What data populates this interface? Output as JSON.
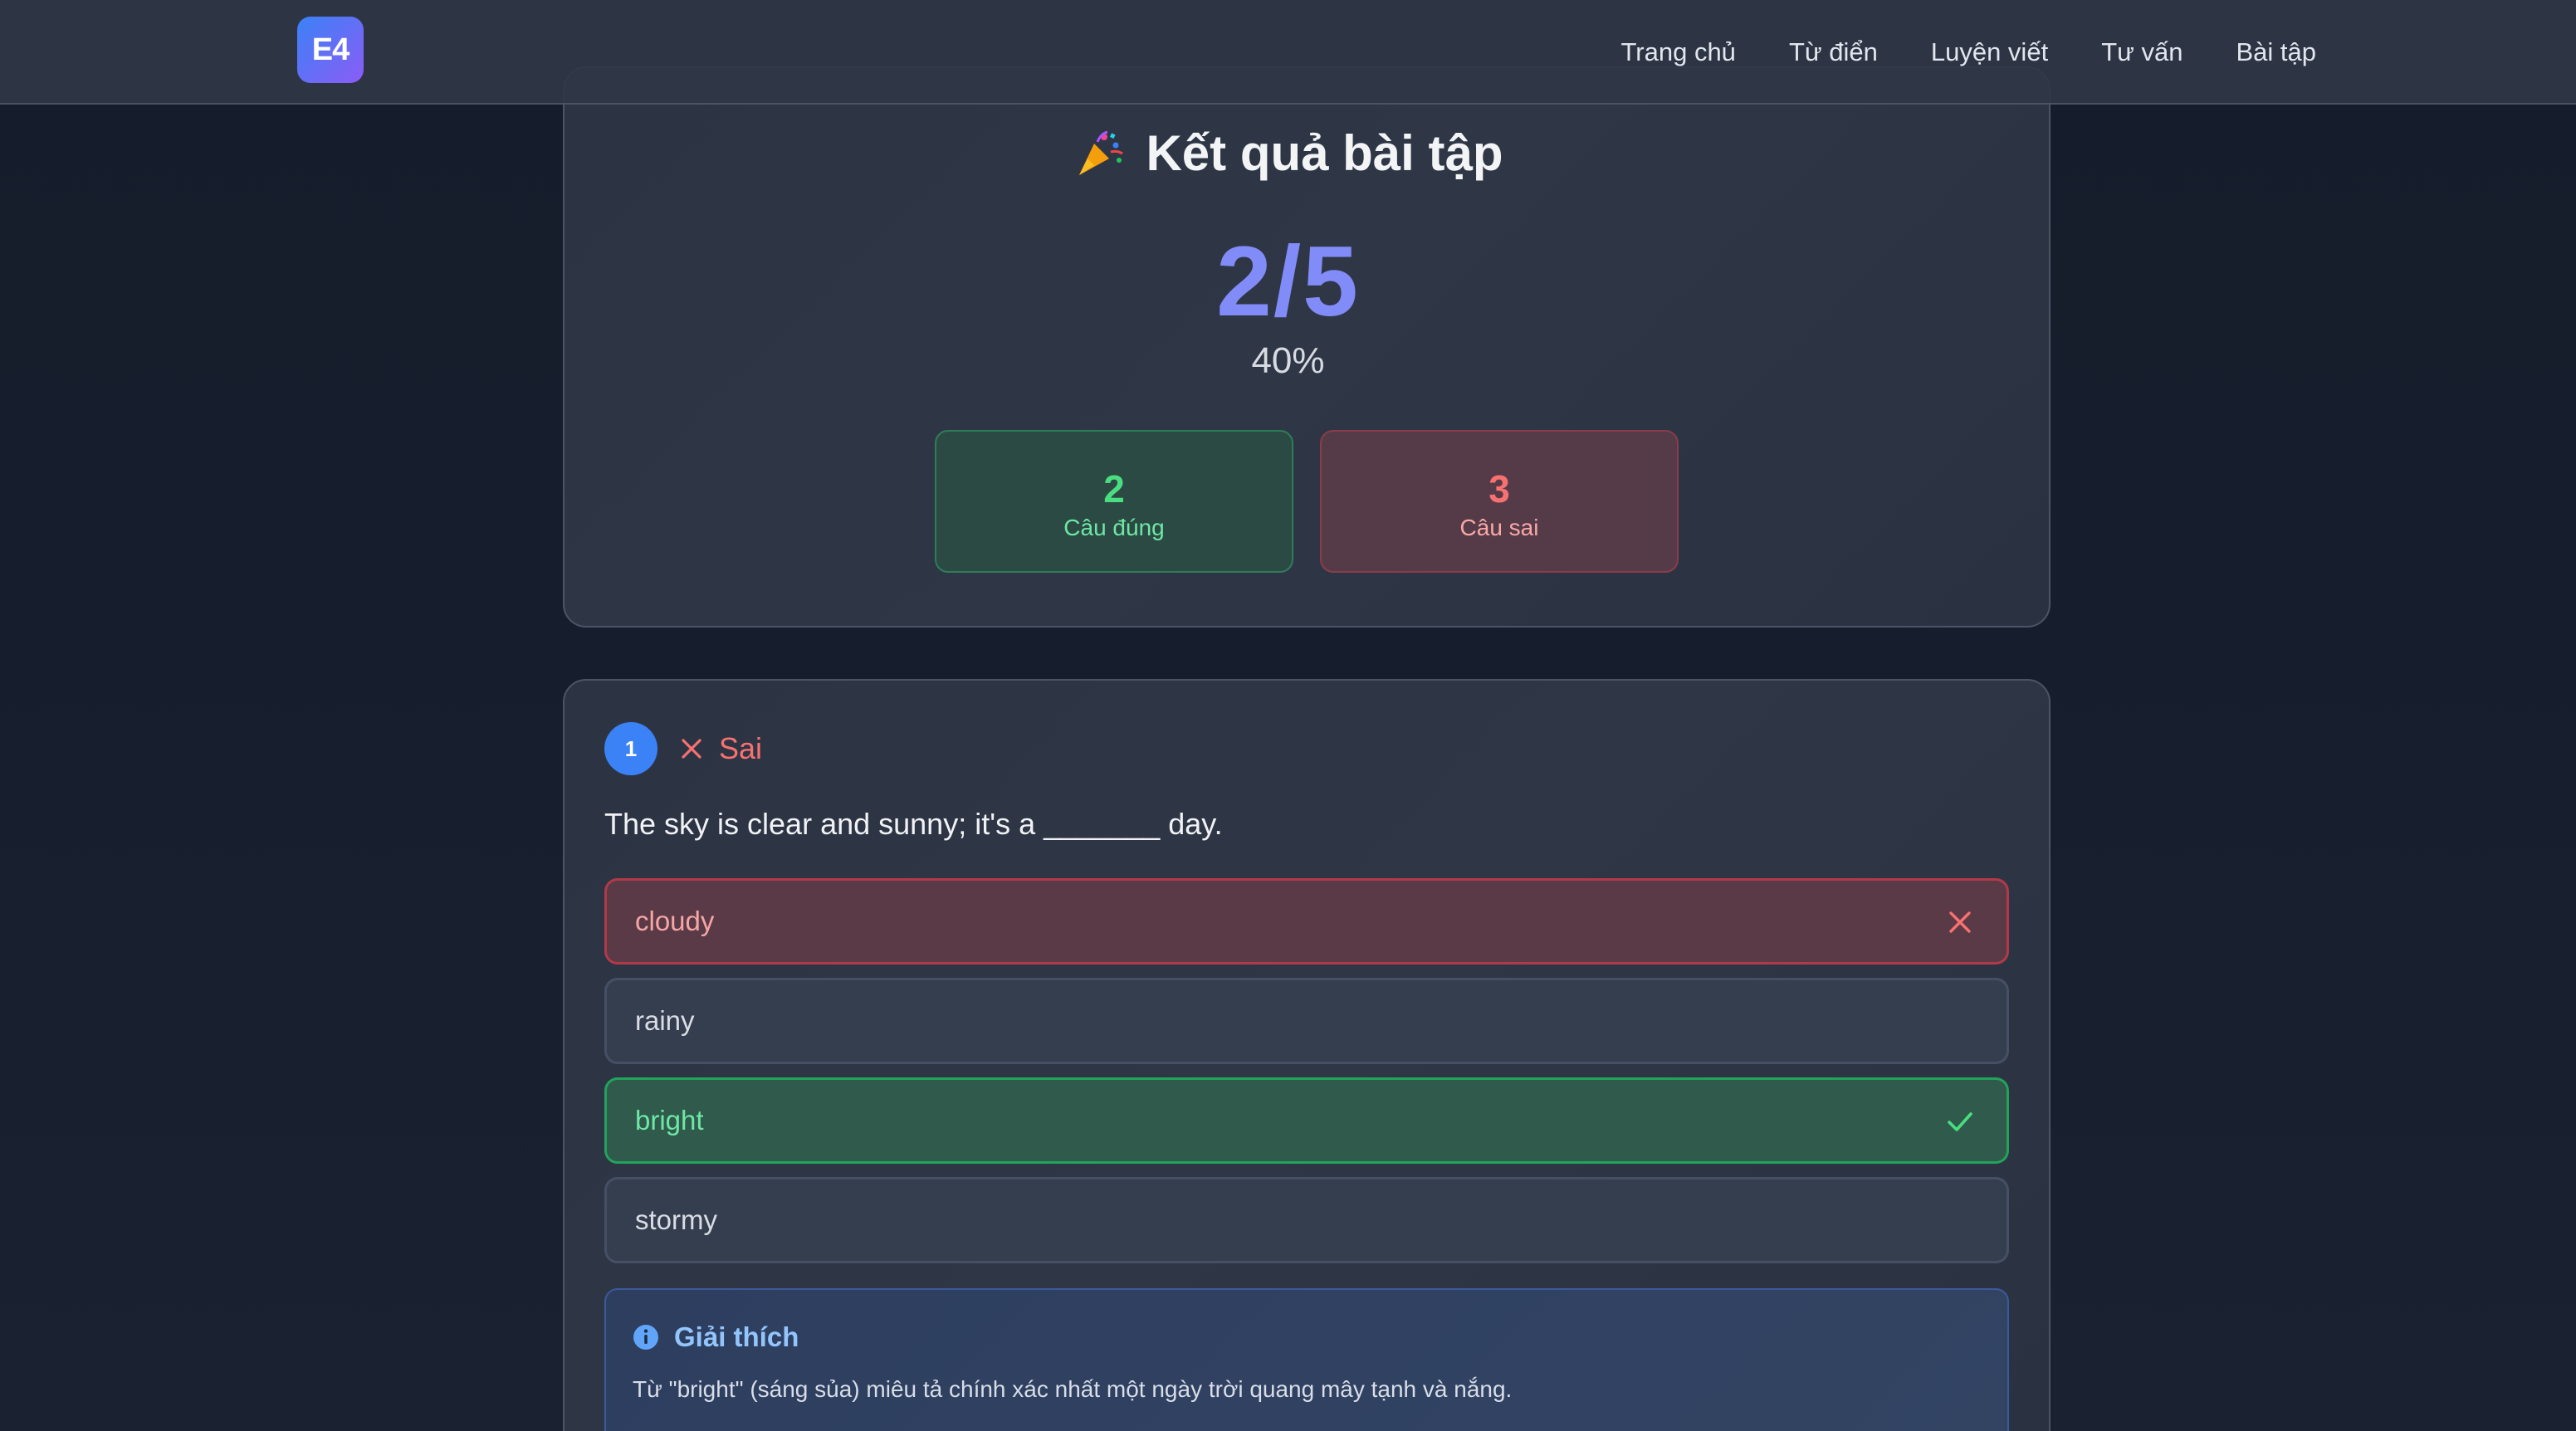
{
  "header": {
    "logo_text": "E4",
    "nav": [
      "Trang chủ",
      "Từ điển",
      "Luyện viết",
      "Tư vấn",
      "Bài tập"
    ]
  },
  "result": {
    "title": "Kết quả bài tập",
    "score": "2/5",
    "percent": "40%",
    "correct_count": "2",
    "correct_label": "Câu đúng",
    "wrong_count": "3",
    "wrong_label": "Câu sai"
  },
  "question": {
    "number": "1",
    "status": "Sai",
    "text": "The sky is clear and sunny; it's a _______ day.",
    "options": [
      {
        "label": "cloudy",
        "state": "wrong"
      },
      {
        "label": "rainy",
        "state": "neutral"
      },
      {
        "label": "bright",
        "state": "correct"
      },
      {
        "label": "stormy",
        "state": "neutral"
      }
    ],
    "explanation_title": "Giải thích",
    "explanation_text": "Từ \"bright\" (sáng sủa) miêu tả chính xác nhất một ngày trời quang mây tạnh và nắng."
  },
  "colors": {
    "accent": "#818cf8",
    "correct": "#4ade80",
    "wrong": "#f87171",
    "info": "#93c5fd"
  }
}
